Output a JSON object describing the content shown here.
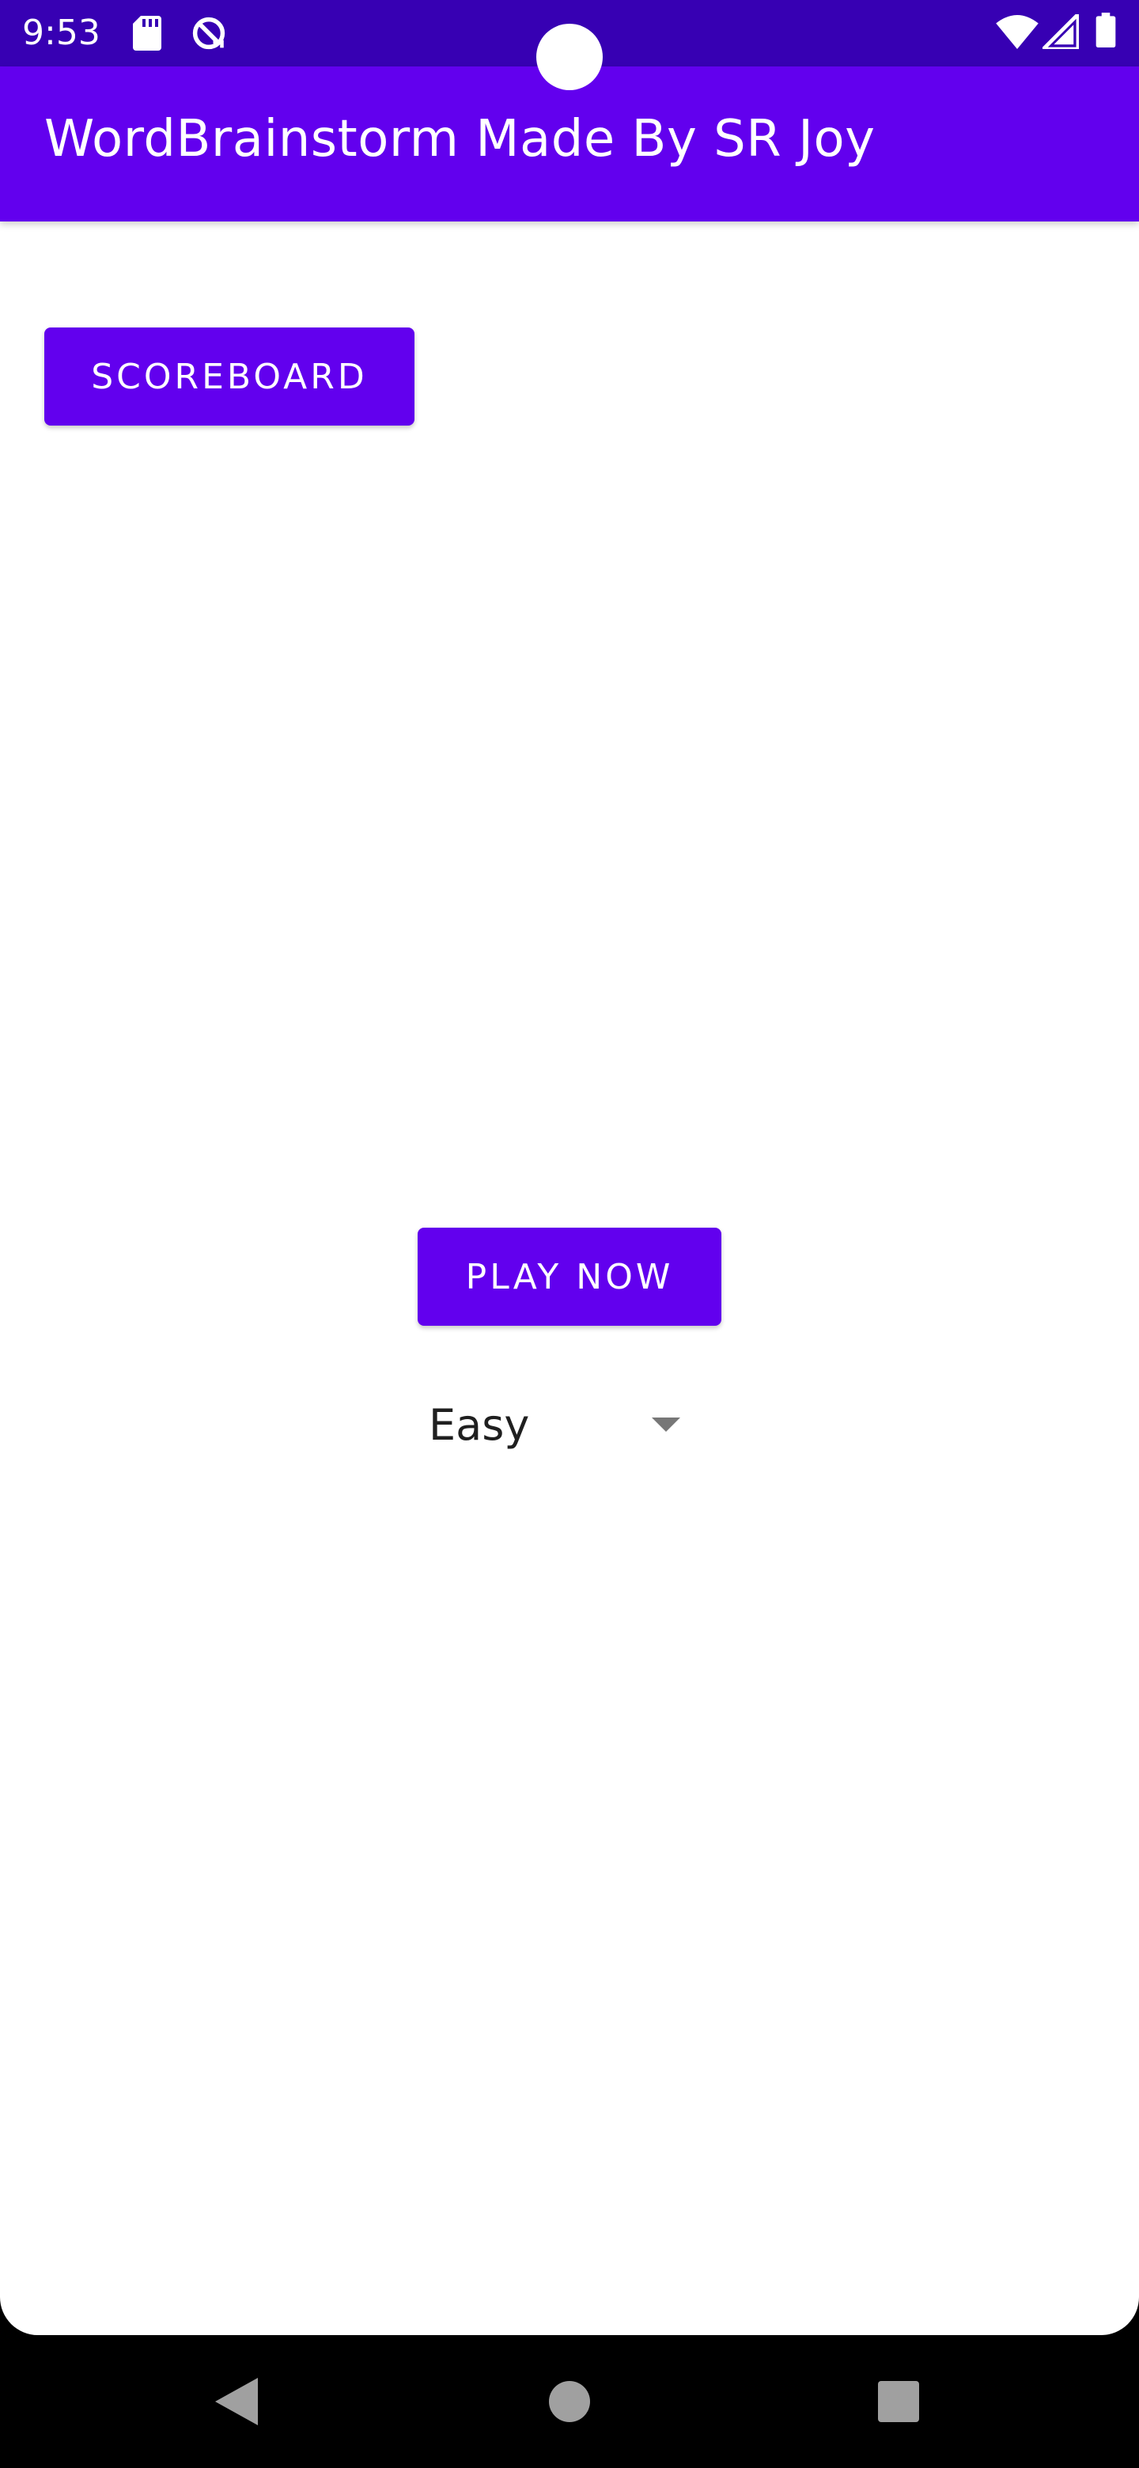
{
  "status_bar": {
    "time": "9:53",
    "left_icons": [
      "sd-card-icon",
      "no-disturb-sync-icon"
    ],
    "right_icons": [
      "wifi-icon",
      "cellular-signal-icon",
      "battery-icon"
    ]
  },
  "app_bar": {
    "title": "WordBrainstorm Made By SR Joy"
  },
  "main": {
    "scoreboard_label": "SCOREBOARD",
    "play_label": "PLAY NOW",
    "difficulty": {
      "selected": "Easy"
    }
  },
  "colors": {
    "status_bar": "#3700b3",
    "app_bar": "#6200ee",
    "button": "#6200ee",
    "background": "#ffffff",
    "nav_bar": "#000000"
  },
  "nav_bar": {
    "icons": [
      "back-icon",
      "home-icon",
      "recents-icon"
    ]
  }
}
